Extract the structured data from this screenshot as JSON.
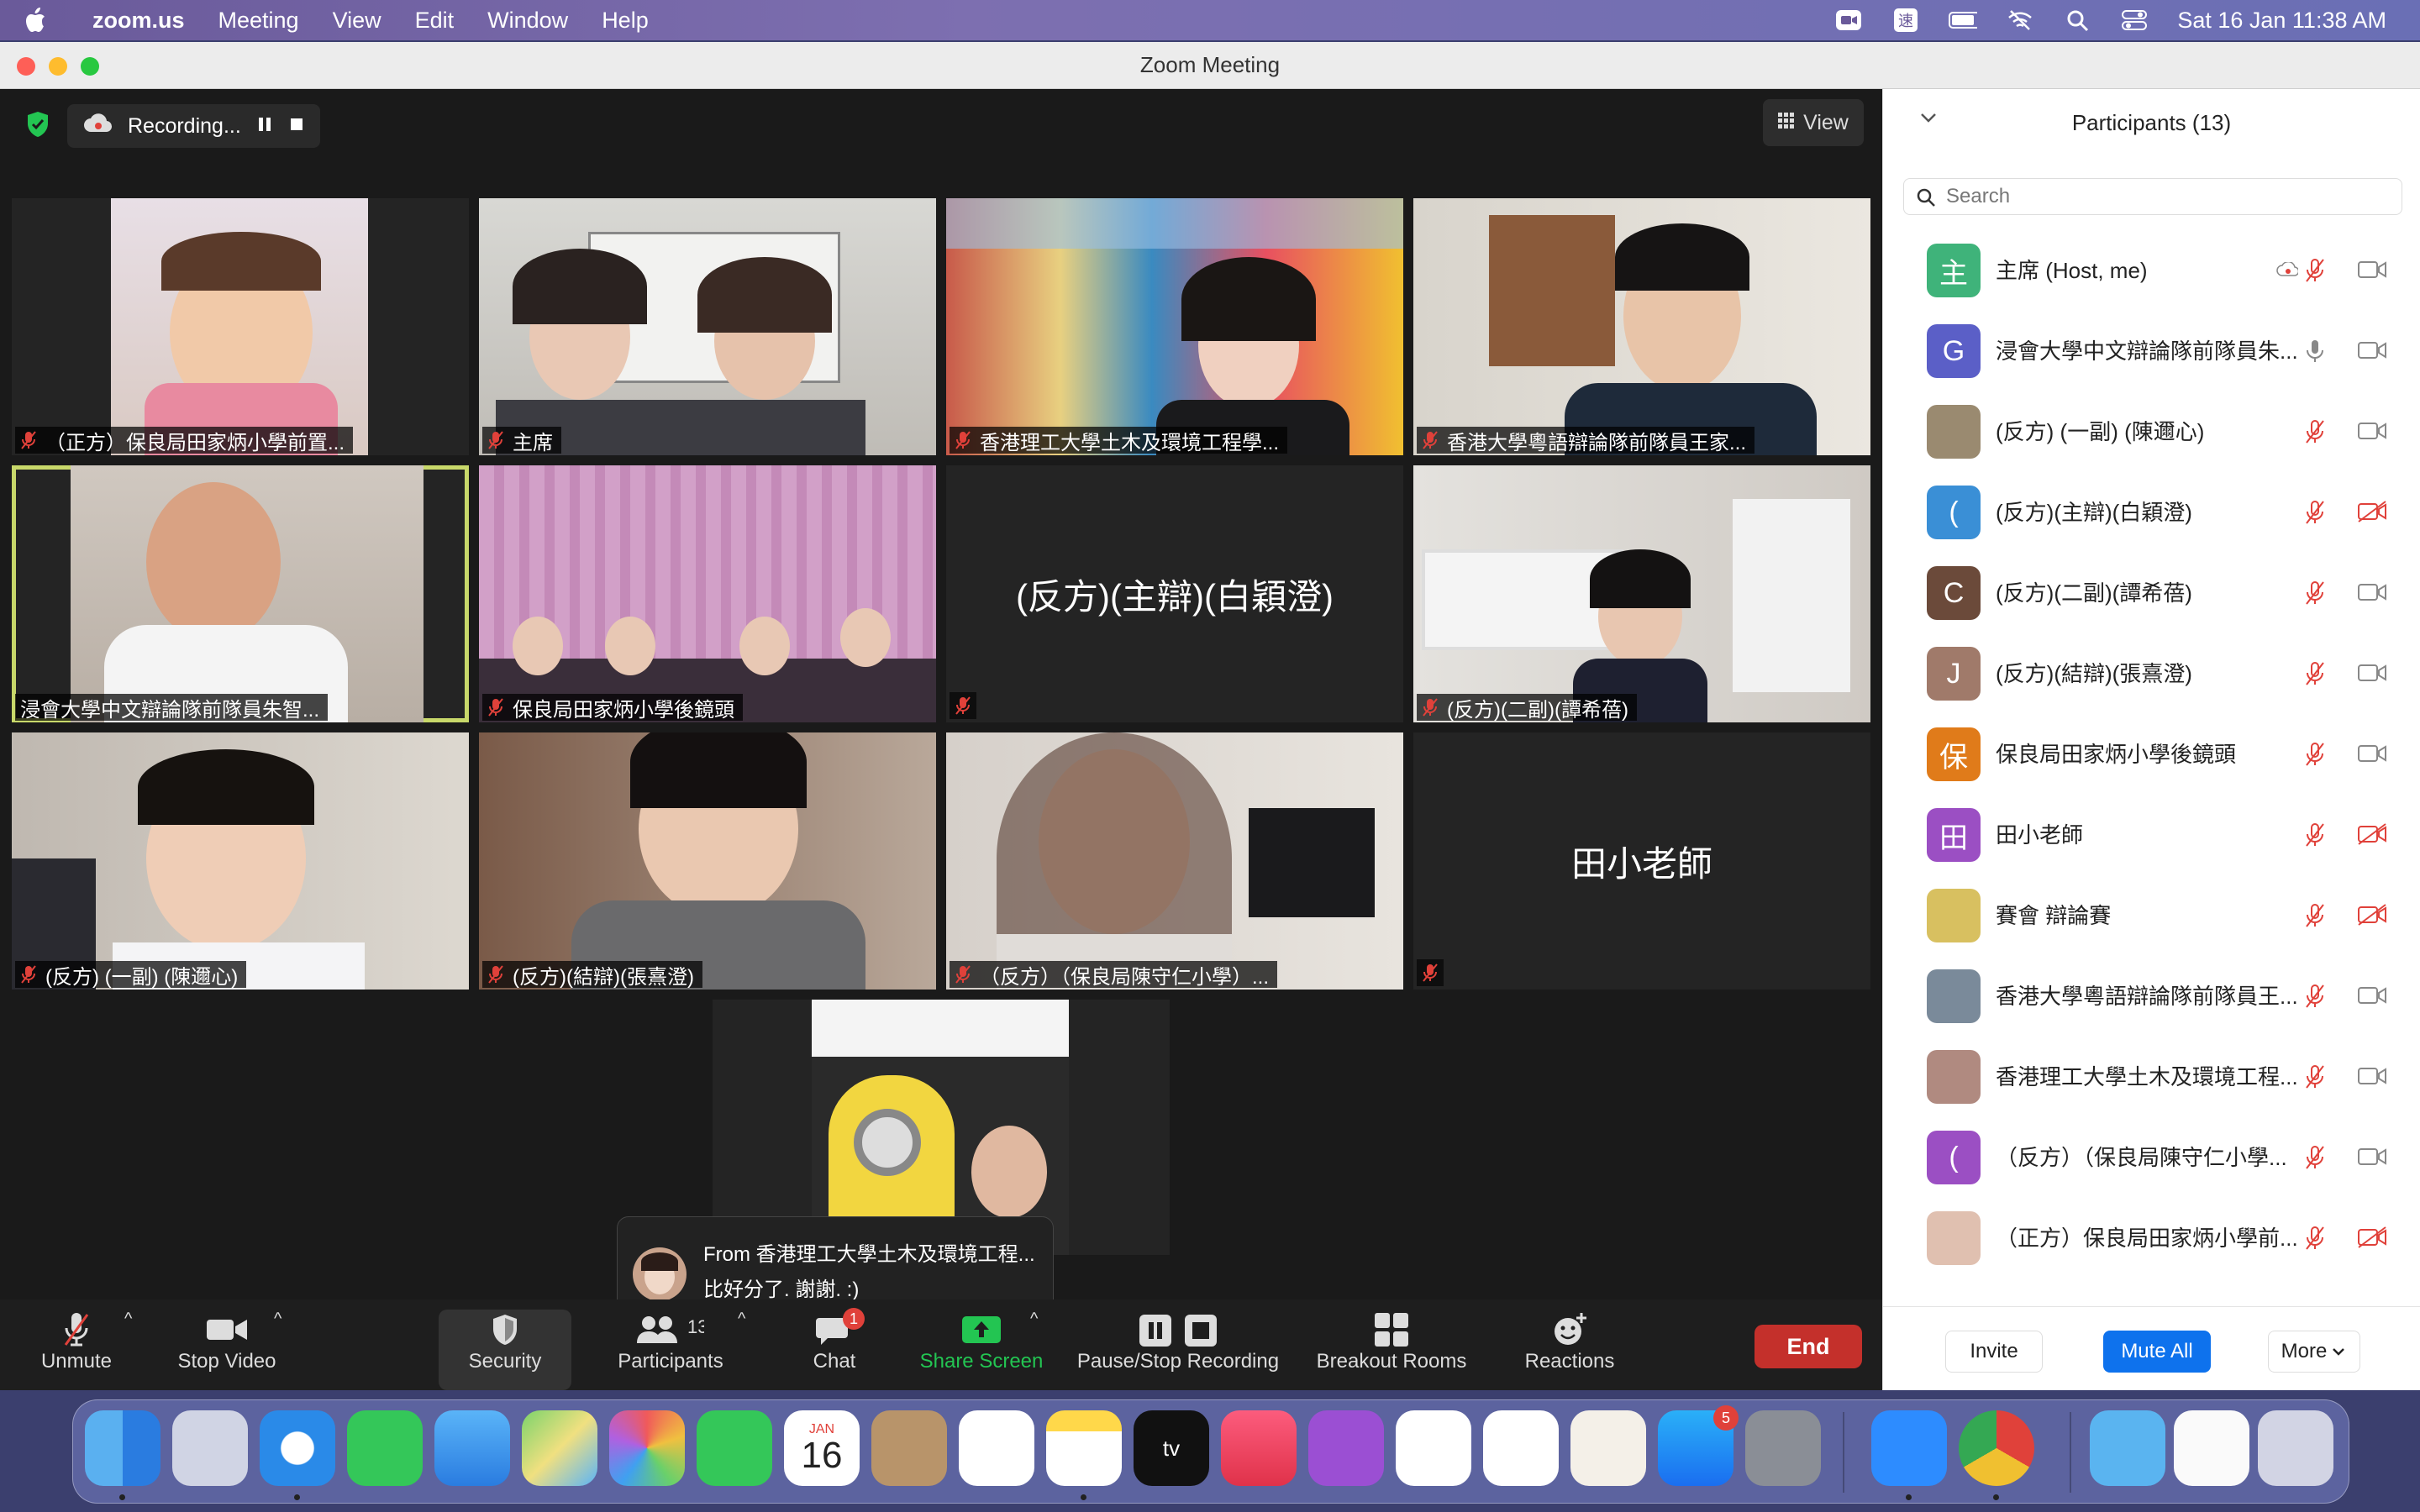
{
  "menubar": {
    "app": "zoom.us",
    "items": [
      "Meeting",
      "View",
      "Edit",
      "Window",
      "Help"
    ],
    "clock": "Sat 16 Jan  11:38 AM"
  },
  "window": {
    "title": "Zoom Meeting"
  },
  "recording": {
    "label": "Recording..."
  },
  "view_label": "View",
  "tiles": [
    {
      "label": "（正方）保良局田家炳小學前置..."
    },
    {
      "label": "主席"
    },
    {
      "label": "香港理工大學土木及環境工程學..."
    },
    {
      "label": "香港大學粵語辯論隊前隊員王家..."
    },
    {
      "label": "浸會大學中文辯論隊前隊員朱智..."
    },
    {
      "label": "保良局田家炳小學後鏡頭"
    },
    {
      "label": "(反方)(主辯)(白穎澄)"
    },
    {
      "label": "(反方)(二副)(譚希蓓)"
    },
    {
      "label": "(反方) (一副) (陳邇心)"
    },
    {
      "label": "(反方)(結辯)(張熹澄)"
    },
    {
      "label": "（反方）（保良局陳守仁小學）..."
    },
    {
      "label": "田小老師"
    }
  ],
  "chat_toast": {
    "from": "From 香港理工大學土木及環境工程...",
    "message": "比好分了. 謝謝. :)"
  },
  "toolbar": {
    "unmute": "Unmute",
    "stop_video": "Stop Video",
    "security": "Security",
    "participants": "Participants",
    "participants_count": "13",
    "chat": "Chat",
    "chat_badge": "1",
    "share_screen": "Share Screen",
    "pause_recording": "Pause/Stop Recording",
    "breakout": "Breakout Rooms",
    "reactions": "Reactions",
    "end": "End"
  },
  "panel": {
    "title": "Participants (13)",
    "search_placeholder": "Search",
    "participants": [
      {
        "initial": "主",
        "name": "主席 (Host, me)",
        "color": "#3fb37a"
      },
      {
        "initial": "G",
        "name": "浸會大學中文辯論隊前隊員朱...",
        "color": "#5b5fc7"
      },
      {
        "initial": "",
        "name": "(反方) (一副) (陳邇心)",
        "color": "#9a8a70"
      },
      {
        "initial": "(",
        "name": "(反方)(主辯)(白穎澄)",
        "color": "#3a8fd6"
      },
      {
        "initial": "C",
        "name": "(反方)(二副)(譚希蓓)",
        "color": "#6b4a3a"
      },
      {
        "initial": "J",
        "name": "(反方)(結辯)(張熹澄)",
        "color": "#a07a6a"
      },
      {
        "initial": "保",
        "name": "保良局田家炳小學後鏡頭",
        "color": "#e07b1a"
      },
      {
        "initial": "田",
        "name": "田小老師",
        "color": "#9b4fc3"
      },
      {
        "initial": "",
        "name": "賽會 辯論賽",
        "color": "#d8c060"
      },
      {
        "initial": "",
        "name": "香港大學粵語辯論隊前隊員王...",
        "color": "#7a8a9a"
      },
      {
        "initial": "",
        "name": "香港理工大學土木及環境工程...",
        "color": "#b08a80"
      },
      {
        "initial": "(",
        "name": "（反方）（保良局陳守仁小學...",
        "color": "#9b4fc3"
      },
      {
        "initial": "",
        "name": "（正方）保良局田家炳小學前...",
        "color": "#e0c0b0"
      }
    ],
    "invite": "Invite",
    "mute_all": "Mute All",
    "more": "More"
  },
  "dock": {
    "calendar_month": "JAN",
    "calendar_day": "16",
    "appstore_badge": "5"
  },
  "colors": {
    "accent": "#0e72ed",
    "end": "#c4302b",
    "share": "#23c552",
    "active_speaker": "#c8d86a"
  }
}
